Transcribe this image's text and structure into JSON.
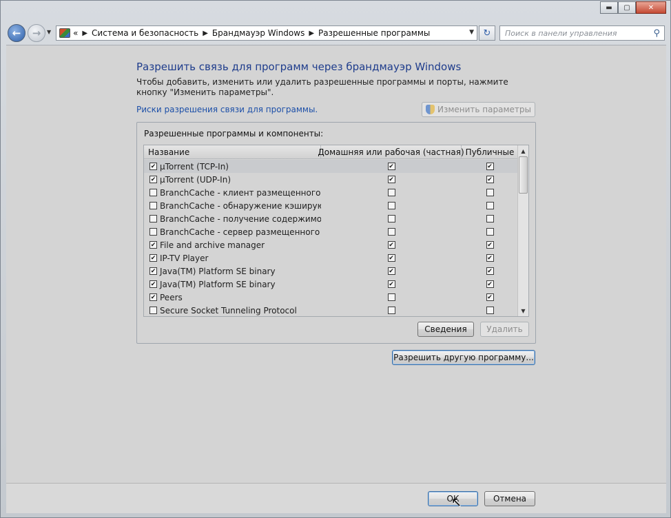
{
  "window": {
    "caption_buttons": {
      "minimize": "▬",
      "maximize": "▢",
      "close": "✕"
    }
  },
  "toolbar": {
    "back_icon": "back-arrow",
    "forward_icon": "forward-arrow",
    "breadcrumb": [
      "Система и безопасность",
      "Брандмауэр Windows",
      "Разрешенные программы"
    ],
    "overflow_marker": "«",
    "search_placeholder": "Поиск в панели управления"
  },
  "main": {
    "title": "Разрешить связь для программ через брандмауэр Windows",
    "description": "Чтобы добавить, изменить или удалить разрешенные программы и порты, нажмите кнопку \"Изменить параметры\".",
    "risk_link": "Риски разрешения связи для программы.",
    "change_settings_label": "Изменить параметры",
    "group_label": "Разрешенные программы и компоненты:",
    "columns": {
      "name": "Название",
      "home": "Домашняя или рабочая (частная)",
      "public": "Публичные"
    },
    "programs": [
      {
        "name": "µTorrent (TCP-In)",
        "enabled": true,
        "home": true,
        "public": true
      },
      {
        "name": "µTorrent (UDP-In)",
        "enabled": true,
        "home": true,
        "public": true
      },
      {
        "name": "BranchCache - клиент размещенного кэ...",
        "enabled": false,
        "home": false,
        "public": false
      },
      {
        "name": "BranchCache - обнаружение кэширующ...",
        "enabled": false,
        "home": false,
        "public": false
      },
      {
        "name": "BranchCache - получение содержимого ...",
        "enabled": false,
        "home": false,
        "public": false
      },
      {
        "name": "BranchCache - сервер размещенного кэ...",
        "enabled": false,
        "home": false,
        "public": false
      },
      {
        "name": "File and archive manager",
        "enabled": true,
        "home": true,
        "public": true
      },
      {
        "name": "IP-TV Player",
        "enabled": true,
        "home": true,
        "public": true
      },
      {
        "name": "Java(TM) Platform SE binary",
        "enabled": true,
        "home": true,
        "public": true
      },
      {
        "name": "Java(TM) Platform SE binary",
        "enabled": true,
        "home": true,
        "public": true
      },
      {
        "name": "Peers",
        "enabled": true,
        "home": false,
        "public": true
      },
      {
        "name": "Secure Socket Tunneling Protocol",
        "enabled": false,
        "home": false,
        "public": false
      }
    ],
    "details_label": "Сведения",
    "delete_label": "Удалить",
    "allow_other_label": "Разрешить другую программу..."
  },
  "footer": {
    "ok_label": "ОК",
    "cancel_label": "Отмена"
  }
}
